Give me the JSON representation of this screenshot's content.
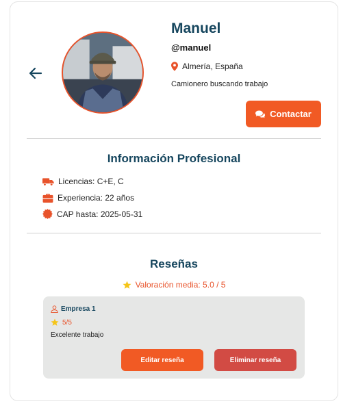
{
  "profile": {
    "name": "Manuel",
    "handle": "@manuel",
    "location": "Almería, España",
    "bio": "Camionero buscando trabajo",
    "contact_label": "Contactar"
  },
  "professional": {
    "title": "Información Profesional",
    "items": [
      {
        "icon": "truck-icon",
        "text": "Licencias: C+E, C"
      },
      {
        "icon": "briefcase-icon",
        "text": "Experiencia: 22 años"
      },
      {
        "icon": "certificate-icon",
        "text": "CAP hasta: 2025-05-31"
      }
    ]
  },
  "reviews": {
    "title": "Reseñas",
    "average_label": "Valoración media: 5.0 / 5",
    "items": [
      {
        "author": "Empresa 1",
        "score": "5/5",
        "text": "Excelente trabajo",
        "edit_label": "Editar reseña",
        "delete_label": "Eliminar reseña"
      }
    ]
  },
  "colors": {
    "primary": "#16465e",
    "accent": "#f15a24",
    "danger": "#d24b44",
    "star": "#f5c518"
  }
}
